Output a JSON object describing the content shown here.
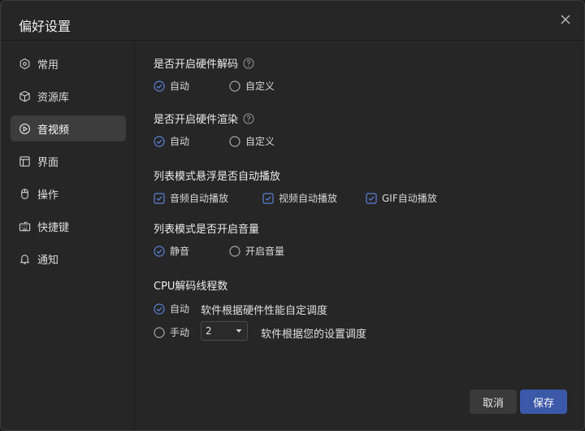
{
  "dialog": {
    "title": "偏好设置"
  },
  "sidebar": {
    "items": [
      {
        "label": "常用",
        "icon": "hexagon-icon"
      },
      {
        "label": "资源库",
        "icon": "cube-icon"
      },
      {
        "label": "音视频",
        "icon": "play-circle-icon",
        "active": true
      },
      {
        "label": "界面",
        "icon": "layout-icon"
      },
      {
        "label": "操作",
        "icon": "mouse-icon"
      },
      {
        "label": "快捷键",
        "icon": "keyboard-icon"
      },
      {
        "label": "通知",
        "icon": "bell-icon"
      }
    ]
  },
  "hw_decode": {
    "title": "是否开启硬件解码",
    "options": [
      {
        "label": "自动",
        "selected": true
      },
      {
        "label": "自定义",
        "selected": false
      }
    ]
  },
  "hw_render": {
    "title": "是否开启硬件渲染",
    "options": [
      {
        "label": "自动",
        "selected": true
      },
      {
        "label": "自定义",
        "selected": false
      }
    ]
  },
  "autoplay": {
    "title": "列表模式悬浮是否自动播放",
    "options": [
      {
        "label": "音频自动播放",
        "checked": true
      },
      {
        "label": "视频自动播放",
        "checked": true
      },
      {
        "label": "GIF自动播放",
        "checked": true
      }
    ]
  },
  "volume": {
    "title": "列表模式是否开启音量",
    "options": [
      {
        "label": "静音",
        "selected": true
      },
      {
        "label": "开启音量",
        "selected": false
      }
    ]
  },
  "cpu": {
    "title": "CPU解码线程数",
    "auto_label": "自动",
    "auto_desc": "软件根据硬件性能自定调度",
    "manual_label": "手动",
    "manual_value": "2",
    "manual_desc": "软件根据您的设置调度"
  },
  "buttons": {
    "cancel": "取消",
    "save": "保存"
  },
  "colors": {
    "accent": "#5b82d9",
    "primary_button": "#3c58a8"
  }
}
